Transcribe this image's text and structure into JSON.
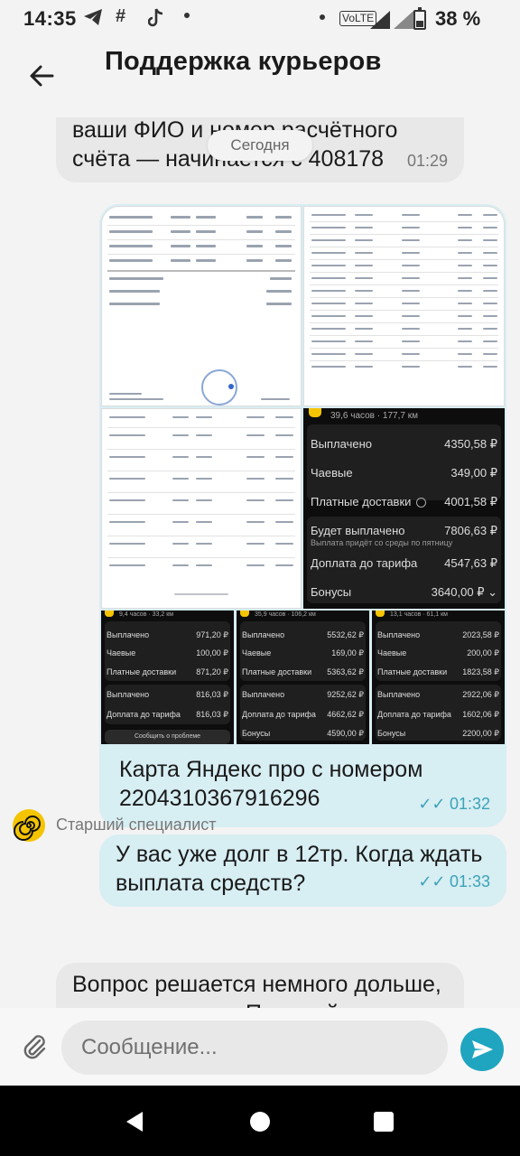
{
  "status_bar": {
    "time": "14:35",
    "battery_percent_label": "38 %",
    "battery_level": 0.38,
    "network_label": "VoLTE",
    "icons": [
      "telegram-icon",
      "hashtag-icon",
      "tiktok-icon",
      "dot-icon",
      "dot-icon",
      "signal-icon",
      "signal-icon",
      "battery-icon"
    ]
  },
  "header": {
    "title": "Поддержка курьеров",
    "back_icon": "arrow-left-icon"
  },
  "chat": {
    "date_separator": "Сегодня",
    "messages": [
      {
        "direction": "incoming",
        "text_line1": "ваши ФИО и номер расчётного",
        "text_line2": "счёта — начинается с 408178",
        "time": "01:29"
      },
      {
        "direction": "outgoing",
        "type": "images",
        "count": 7,
        "dark_stats_main": {
          "header": "39,6 часов · 177,7 км",
          "rows": [
            {
              "label": "Выплачено",
              "value": "4350,58 ₽"
            },
            {
              "label": "Чаевые",
              "value": "349,00 ₽"
            },
            {
              "label": "Платные доставки",
              "value": "4001,58 ₽"
            },
            {
              "label": "Будет выплачено",
              "value": "7806,63 ₽"
            },
            {
              "label": "Выплата придёт со среды по пятницу",
              "value": ""
            },
            {
              "label": "Доплата до тарифа",
              "value": "4547,63 ₽"
            },
            {
              "label": "Бонусы",
              "value": "3640,00 ₽"
            }
          ]
        },
        "dark_stats_small": [
          {
            "header": "9,4 часов · 33,2 км",
            "rows": [
              {
                "label": "Выплачено",
                "value": "971,20 ₽"
              },
              {
                "label": "Чаевые",
                "value": "100,00 ₽"
              },
              {
                "label": "Платные доставки",
                "value": "871,20 ₽"
              },
              {
                "label": "Выплачено",
                "value": "816,03 ₽"
              },
              {
                "label": "Доплата до тарифа",
                "value": "816,03 ₽"
              }
            ],
            "footer": "Сообщить о проблеме"
          },
          {
            "header": "35,9 часов · 106,2 км",
            "rows": [
              {
                "label": "Выплачено",
                "value": "5532,62 ₽"
              },
              {
                "label": "Чаевые",
                "value": "169,00 ₽"
              },
              {
                "label": "Платные доставки",
                "value": "5363,62 ₽"
              },
              {
                "label": "Выплачено",
                "value": "9252,62 ₽"
              },
              {
                "label": "Доплата до тарифа",
                "value": "4662,62 ₽"
              },
              {
                "label": "Бонусы",
                "value": "4590,00 ₽"
              }
            ],
            "footer": ""
          },
          {
            "header": "13,1 часов · 61,1 км",
            "rows": [
              {
                "label": "Выплачено",
                "value": "2023,58 ₽"
              },
              {
                "label": "Чаевые",
                "value": "200,00 ₽"
              },
              {
                "label": "Платные доставки",
                "value": "1823,58 ₽"
              },
              {
                "label": "Выплачено",
                "value": "2922,06 ₽"
              },
              {
                "label": "Доплата до тарифа",
                "value": "1602,06 ₽"
              },
              {
                "label": "Бонусы",
                "value": "2200,00 ₽"
              }
            ],
            "footer": ""
          }
        ]
      },
      {
        "direction": "outgoing",
        "text_line1": "Карта Яндекс про с номером",
        "text_line2": "2204310367916296",
        "time": "01:32",
        "read": "✓✓"
      },
      {
        "direction": "outgoing",
        "text_line1": "У вас уже долг в 12тр. Когда ждать",
        "text_line2": "выплата средств?",
        "time": "01:33",
        "read": "✓✓"
      },
      {
        "direction": "incoming",
        "sender": "Старший специалист",
        "text_line1": "Вопрос решается немного дольше,",
        "text_line2": "чем ожидалось. Пожалуйста,"
      }
    ]
  },
  "input": {
    "placeholder": "Сообщение...",
    "attach_icon": "paperclip-icon",
    "send_icon": "send-icon"
  },
  "nav_bar": {
    "icons": [
      "back-triangle-icon",
      "home-circle-icon",
      "recents-square-icon"
    ]
  },
  "colors": {
    "accent": "#1fa5c0",
    "outgoing_bubble": "#d7eef3",
    "incoming_bubble": "#e8e8e8",
    "avatar": "#f5c400"
  }
}
